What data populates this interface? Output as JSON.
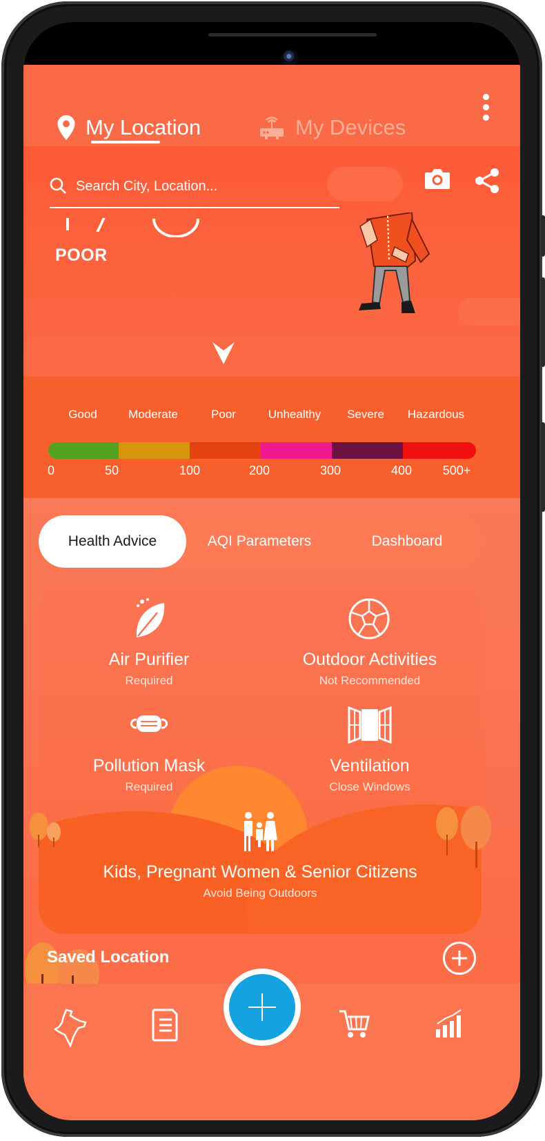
{
  "header": {
    "tabs": [
      {
        "label": "My Location",
        "icon": "location-pin-icon",
        "active": true
      },
      {
        "label": "My Devices",
        "icon": "router-icon",
        "active": false
      }
    ]
  },
  "search": {
    "placeholder": "Search City, Location..."
  },
  "aqi": {
    "status": "POOR"
  },
  "scale": {
    "labels": [
      "Good",
      "Moderate",
      "Poor",
      "Unhealthy",
      "Severe",
      "Hazardous"
    ],
    "numbers": [
      "0",
      "50",
      "100",
      "200",
      "300",
      "400",
      "500+"
    ],
    "colors": [
      "#53a321",
      "#d6960c",
      "#e6420f",
      "#f01a8c",
      "#6b1241",
      "#f20f0f"
    ]
  },
  "segments": [
    {
      "label": "Health Advice",
      "active": true
    },
    {
      "label": "AQI Parameters",
      "active": false
    },
    {
      "label": "Dashboard",
      "active": false
    }
  ],
  "advice": [
    {
      "title": "Air Purifier",
      "status": "Required",
      "icon": "leaf-icon"
    },
    {
      "title": "Outdoor Activities",
      "status": "Not Recommended",
      "icon": "soccer-ball-icon"
    },
    {
      "title": "Pollution Mask",
      "status": "Required",
      "icon": "mask-icon"
    },
    {
      "title": "Ventilation",
      "status": "Close Windows",
      "icon": "window-icon"
    },
    {
      "title": "Kids, Pregnant Women & Senior Citizens",
      "status": "Avoid Being Outdoors",
      "icon": "family-icon"
    }
  ],
  "saved": {
    "title": "Saved Location"
  },
  "bottom_nav": [
    "india-map-icon",
    "report-icon",
    "add-icon",
    "cart-icon",
    "bar-chart-icon"
  ],
  "colors": {
    "accent": "#fb6a46",
    "fab": "#13a1df"
  }
}
